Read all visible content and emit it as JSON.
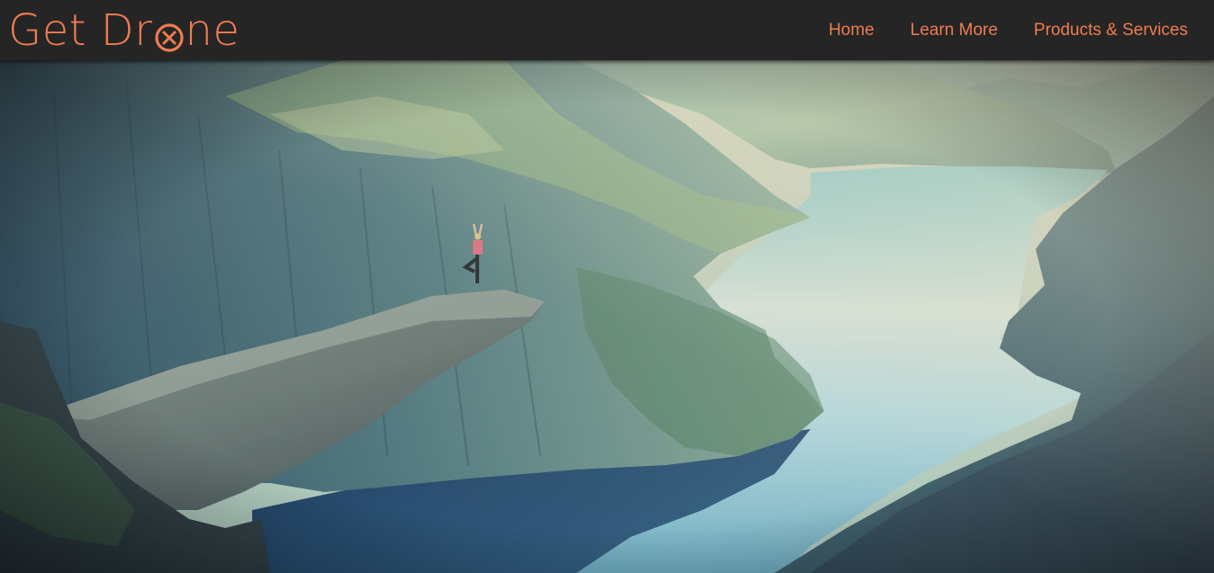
{
  "brand": {
    "text_before": "Get Dr",
    "text_after": "ne",
    "o_icon": "drone-rotor-icon"
  },
  "nav": {
    "items": [
      {
        "label": "Home"
      },
      {
        "label": "Learn More"
      },
      {
        "label": "Products & Services"
      }
    ]
  },
  "hero": {
    "image": "mountain-fjord-yoga-cliff-photo"
  },
  "colors": {
    "accent": "#ef7c50",
    "navbar_bg": "#252525"
  }
}
